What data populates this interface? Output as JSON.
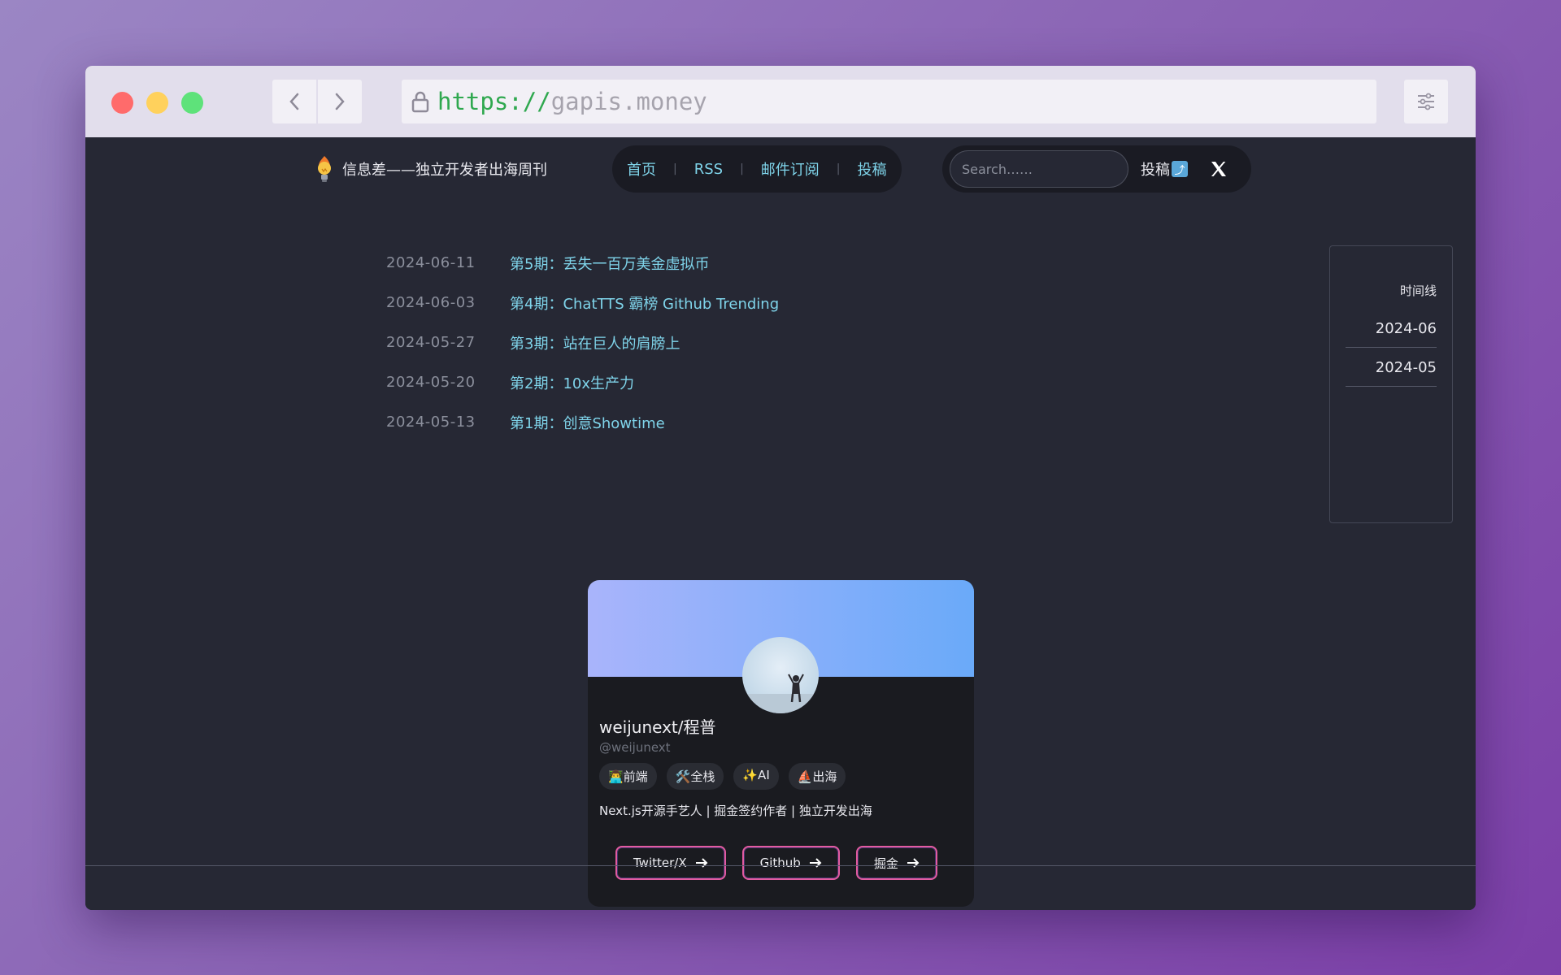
{
  "browser": {
    "url_scheme": "https://",
    "url_host": "gapis.money"
  },
  "header": {
    "brand_title": "信息差——独立开发者出海周刊",
    "nav": [
      {
        "label": "首页"
      },
      {
        "label": "RSS"
      },
      {
        "label": "邮件订阅"
      },
      {
        "label": "投稿"
      }
    ],
    "search_placeholder": "Search……",
    "submit_label": "投稿",
    "submit_icon": "⤴"
  },
  "issues": [
    {
      "date": "2024-06-11",
      "title": "第5期：丢失一百万美金虚拟币"
    },
    {
      "date": "2024-06-03",
      "title": "第4期：ChatTTS 霸榜 Github Trending"
    },
    {
      "date": "2024-05-27",
      "title": "第3期：站在巨人的肩膀上"
    },
    {
      "date": "2024-05-20",
      "title": "第2期：10x生产力"
    },
    {
      "date": "2024-05-13",
      "title": "第1期：创意Showtime"
    }
  ],
  "timeline": {
    "title": "时间线",
    "months": [
      "2024-06",
      "2024-05"
    ]
  },
  "profile": {
    "name": "weijunext/程普",
    "handle": "@weijunext",
    "tags": [
      "👨‍💻前端",
      "🛠️全栈",
      "✨AI",
      "⛵出海"
    ],
    "bio": "Next.js开源手艺人 | 掘金签约作者 | 独立开发出海",
    "buttons": [
      "Twitter/X",
      "Github",
      "掘金"
    ]
  },
  "colors": {
    "accent_link": "#7fd4ea",
    "button_border": "#e25ba0"
  }
}
